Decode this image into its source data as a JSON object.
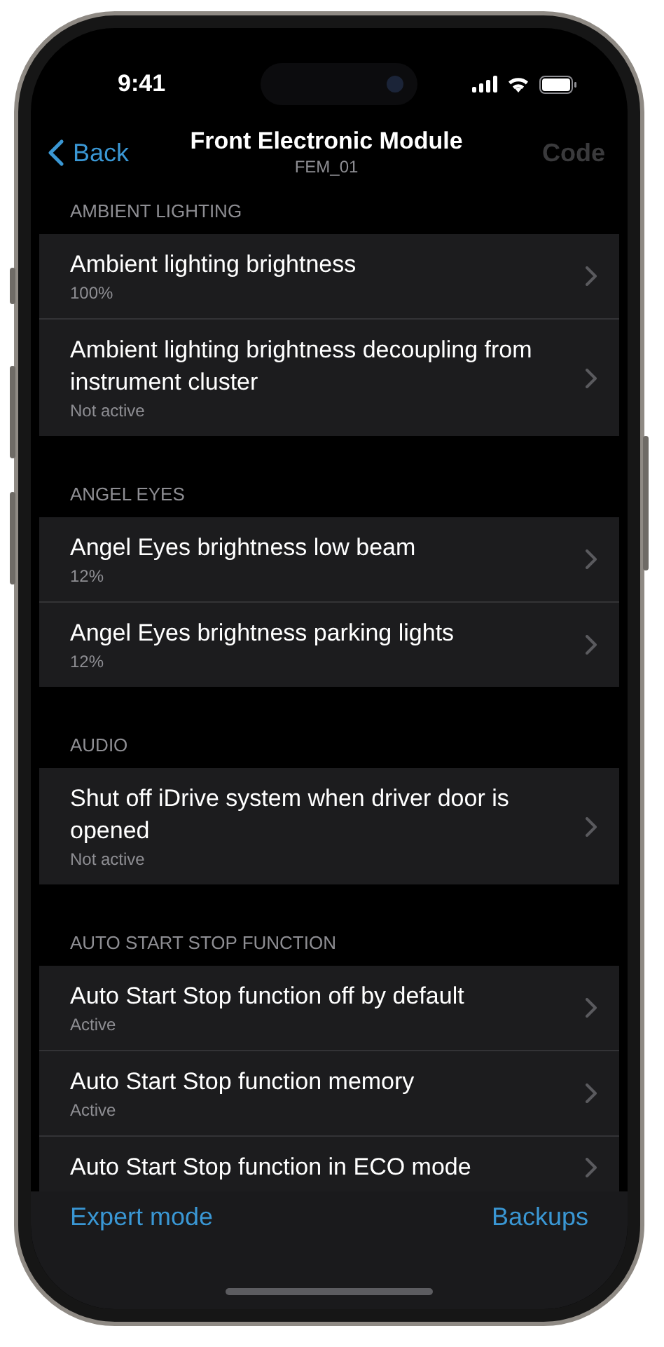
{
  "status_bar": {
    "time": "9:41"
  },
  "nav": {
    "back": "Back",
    "title": "Front Electronic Module",
    "subtitle": "FEM_01",
    "action": {
      "label": "Code",
      "disabled": true
    }
  },
  "sections": [
    {
      "header": "AMBIENT LIGHTING",
      "rows": [
        {
          "title": "Ambient lighting brightness",
          "value": "100%"
        },
        {
          "title": "Ambient lighting brightness decoupling from instrument cluster",
          "value": "Not active"
        }
      ]
    },
    {
      "header": "ANGEL EYES",
      "rows": [
        {
          "title": "Angel Eyes brightness low beam",
          "value": "12%"
        },
        {
          "title": "Angel Eyes brightness parking lights",
          "value": "12%"
        }
      ]
    },
    {
      "header": "AUDIO",
      "rows": [
        {
          "title": "Shut off iDrive system when driver door is opened",
          "value": "Not active"
        }
      ]
    },
    {
      "header": "AUTO START STOP FUNCTION",
      "rows": [
        {
          "title": "Auto Start Stop function off by default",
          "value": "Active"
        },
        {
          "title": "Auto Start Stop function memory",
          "value": "Active"
        },
        {
          "title": "Auto Start Stop function in ECO mode"
        }
      ]
    }
  ],
  "toolbar": {
    "left": "Expert mode",
    "right": "Backups"
  }
}
